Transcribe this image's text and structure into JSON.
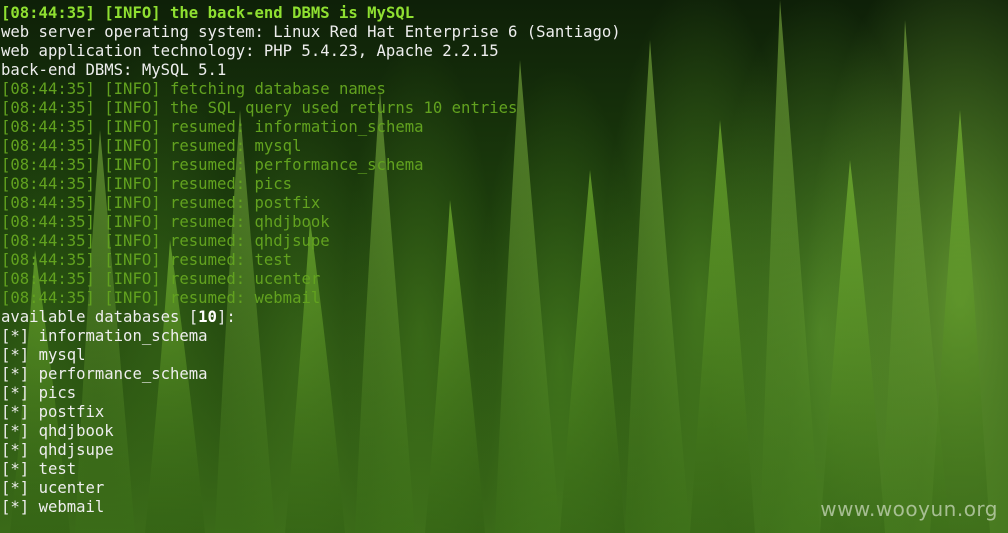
{
  "header_line": {
    "time": "08:44:35",
    "level": "INFO",
    "message": "the back-end DBMS is MySQL"
  },
  "server_info": [
    {
      "label": "web server operating system:",
      "value": "Linux Red Hat Enterprise 6 (Santiago)"
    },
    {
      "label": "web application technology:",
      "value": "PHP 5.4.23, Apache 2.2.15"
    },
    {
      "label": "back-end DBMS:",
      "value": "MySQL 5.1"
    }
  ],
  "log_lines": [
    {
      "time": "08:44:35",
      "level": "INFO",
      "message": "fetching database names"
    },
    {
      "time": "08:44:35",
      "level": "INFO",
      "message": "the SQL query used returns 10 entries"
    },
    {
      "time": "08:44:35",
      "level": "INFO",
      "message": "resumed: information_schema"
    },
    {
      "time": "08:44:35",
      "level": "INFO",
      "message": "resumed: mysql"
    },
    {
      "time": "08:44:35",
      "level": "INFO",
      "message": "resumed: performance_schema"
    },
    {
      "time": "08:44:35",
      "level": "INFO",
      "message": "resumed: pics"
    },
    {
      "time": "08:44:35",
      "level": "INFO",
      "message": "resumed: postfix"
    },
    {
      "time": "08:44:35",
      "level": "INFO",
      "message": "resumed: qhdjbook"
    },
    {
      "time": "08:44:35",
      "level": "INFO",
      "message": "resumed: qhdjsupe"
    },
    {
      "time": "08:44:35",
      "level": "INFO",
      "message": "resumed: test"
    },
    {
      "time": "08:44:35",
      "level": "INFO",
      "message": "resumed: ucenter"
    },
    {
      "time": "08:44:35",
      "level": "INFO",
      "message": "resumed: webmail"
    }
  ],
  "available": {
    "label": "available databases",
    "count": "10",
    "bullet": "[*]",
    "databases": [
      "information_schema",
      "mysql",
      "performance_schema",
      "pics",
      "postfix",
      "qhdjbook",
      "qhdjsupe",
      "test",
      "ucenter",
      "webmail"
    ]
  },
  "watermark": "www.wooyun.org"
}
